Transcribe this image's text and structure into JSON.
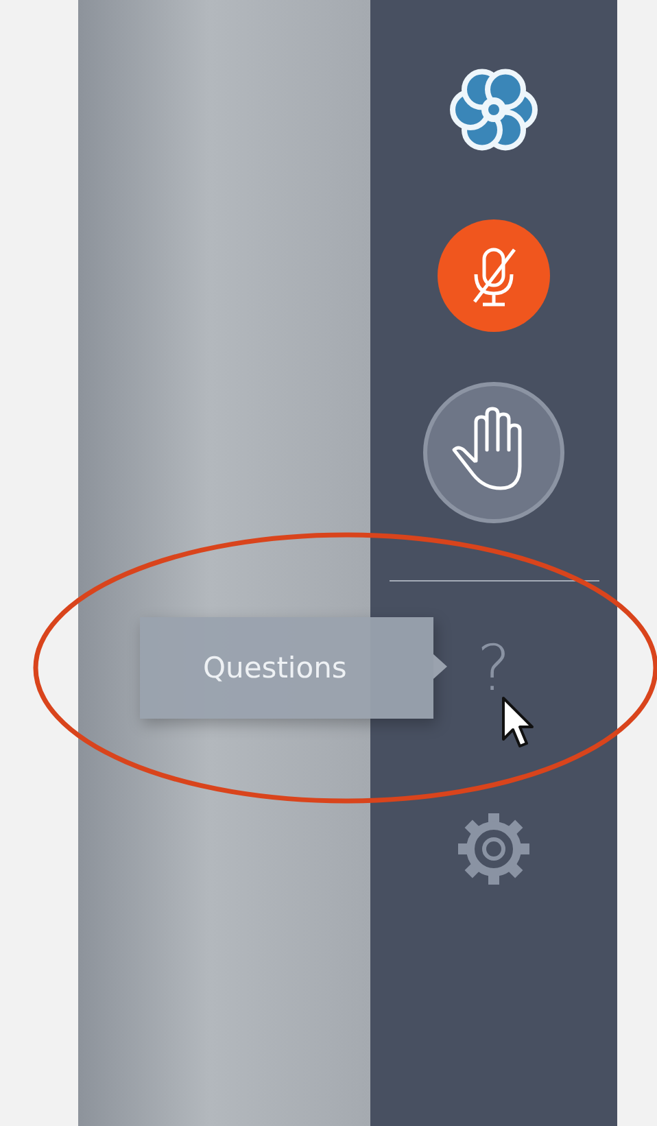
{
  "sidebar": {
    "items": [
      {
        "kind": "logo"
      },
      {
        "kind": "mic",
        "muted": true
      },
      {
        "kind": "hand",
        "raised": false
      },
      {
        "kind": "divider"
      },
      {
        "kind": "help",
        "label": "?"
      },
      {
        "kind": "settings"
      }
    ]
  },
  "tooltip": {
    "text": "Questions"
  },
  "annotation": {
    "kind": "ellipse"
  }
}
